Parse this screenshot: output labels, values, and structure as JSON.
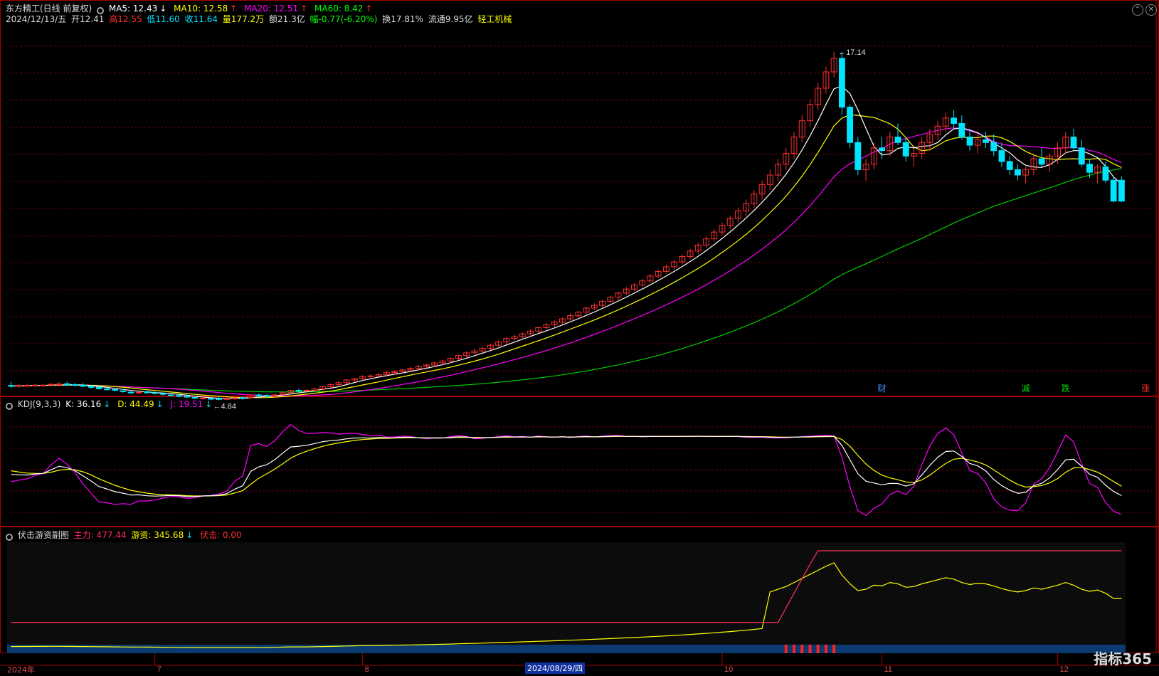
{
  "main_panel": {
    "title": "东方精工(日线 前复权)",
    "ma": [
      {
        "label": "MA5: 12.43",
        "arrow": "↓",
        "color": "#ffffff"
      },
      {
        "label": "MA10: 12.58",
        "arrow": "↑",
        "color": "#ffff00"
      },
      {
        "label": "MA20: 12.51",
        "arrow": "↑",
        "color": "#ff00ff"
      },
      {
        "label": "MA60: 8.42",
        "arrow": "↑",
        "color": "#00ff00"
      }
    ],
    "info": {
      "date": "2024/12/13/五",
      "open": "开12.41",
      "high": "高12.55",
      "low": "低11.60",
      "close": "收11.64",
      "volume": "量177.2万",
      "amount": "额21.3亿",
      "change": "幅-0.77(-6.20%)",
      "turnover": "换17.81%",
      "float": "流通9.95亿",
      "sector": "轻工机械"
    },
    "max_label": "17.14",
    "min_label": "4.84",
    "signals": [
      {
        "text": "财",
        "color": "#4a90ff",
        "day": 109
      },
      {
        "text": "减",
        "color": "#00e000",
        "day": 127
      },
      {
        "text": "跌",
        "color": "#00e000",
        "day": 132
      },
      {
        "text": "涨",
        "color": "#ff3030",
        "day": 142
      }
    ]
  },
  "kdj_panel": {
    "name": "KDJ(9,3,3)",
    "values": [
      {
        "label": "K: 36.16",
        "arrow": "↓",
        "color": "#ffffff"
      },
      {
        "label": "D: 44.49",
        "arrow": "↓",
        "color": "#ffff00"
      },
      {
        "label": "J: 19.51",
        "arrow": "↓",
        "color": "#ff00ff"
      }
    ]
  },
  "sub_panel": {
    "name": "伏击游资副图",
    "values": [
      {
        "label": "主力: 477.44",
        "color": "#ff3060"
      },
      {
        "label": "游资: 345.68",
        "color": "#ffff00",
        "arrow": "↓"
      },
      {
        "label": "伏击: 0.00",
        "color": "#ff3030"
      }
    ]
  },
  "x_axis": {
    "year_label": "2024年",
    "month_labels": [
      {
        "text": "7",
        "day": 18
      },
      {
        "text": "8",
        "day": 44
      },
      {
        "text": "10",
        "day": 89
      },
      {
        "text": "11",
        "day": 109
      },
      {
        "text": "12",
        "day": 131
      }
    ],
    "cursor_date": "2024/08/29/四"
  },
  "brand": "指标365",
  "colors": {
    "up": "#ff3030",
    "down": "#00e5ff",
    "ma5": "#ffffff",
    "ma10": "#ffff00",
    "ma20": "#ff00ff",
    "ma60": "#00cc00",
    "grid": "#6a0000",
    "frame": "#a00000"
  },
  "chart_data": {
    "type": "candlestick",
    "y_range": [
      4.5,
      18.0
    ],
    "ohlc": [
      [
        4.85,
        4.98,
        4.76,
        4.82
      ],
      [
        4.82,
        4.9,
        4.76,
        4.85
      ],
      [
        4.85,
        4.92,
        4.8,
        4.85
      ],
      [
        4.84,
        4.92,
        4.79,
        4.86
      ],
      [
        4.85,
        4.91,
        4.79,
        4.86
      ],
      [
        4.87,
        4.94,
        4.82,
        4.89
      ],
      [
        4.89,
        4.98,
        4.81,
        4.9
      ],
      [
        4.91,
        4.99,
        4.83,
        4.87
      ],
      [
        4.88,
        4.95,
        4.81,
        4.85
      ],
      [
        4.86,
        4.93,
        4.78,
        4.82
      ],
      [
        4.82,
        4.87,
        4.73,
        4.78
      ],
      [
        4.78,
        4.85,
        4.7,
        4.73
      ],
      [
        4.72,
        4.79,
        4.66,
        4.71
      ],
      [
        4.7,
        4.74,
        4.63,
        4.67
      ],
      [
        4.65,
        4.71,
        4.58,
        4.63
      ],
      [
        4.6,
        4.66,
        4.54,
        4.58
      ],
      [
        4.59,
        4.66,
        4.54,
        4.6
      ],
      [
        4.62,
        4.68,
        4.54,
        4.58
      ],
      [
        4.58,
        4.63,
        4.52,
        4.56
      ],
      [
        4.55,
        4.6,
        4.48,
        4.53
      ],
      [
        4.5,
        4.56,
        4.44,
        4.49
      ],
      [
        4.48,
        4.55,
        4.41,
        4.45
      ],
      [
        4.45,
        4.51,
        4.39,
        4.42
      ],
      [
        4.41,
        4.46,
        4.34,
        4.38
      ],
      [
        4.38,
        4.44,
        4.33,
        4.38
      ],
      [
        4.37,
        4.42,
        4.31,
        4.36
      ],
      [
        4.36,
        4.42,
        4.3,
        4.35
      ],
      [
        4.36,
        4.41,
        4.31,
        4.36
      ],
      [
        4.37,
        4.44,
        4.31,
        4.39
      ],
      [
        4.4,
        4.45,
        4.32,
        4.39
      ],
      [
        4.4,
        4.53,
        4.36,
        4.5
      ],
      [
        4.5,
        4.56,
        4.41,
        4.47
      ],
      [
        4.48,
        4.53,
        4.4,
        4.46
      ],
      [
        4.46,
        4.55,
        4.41,
        4.5
      ],
      [
        4.52,
        4.61,
        4.48,
        4.58
      ],
      [
        4.58,
        4.68,
        4.53,
        4.67
      ],
      [
        4.67,
        4.73,
        4.62,
        4.66
      ],
      [
        4.66,
        4.72,
        4.6,
        4.67
      ],
      [
        4.67,
        4.76,
        4.62,
        4.72
      ],
      [
        4.72,
        4.83,
        4.67,
        4.8
      ],
      [
        4.8,
        4.92,
        4.76,
        4.88
      ],
      [
        4.88,
        5.0,
        4.8,
        4.95
      ],
      [
        4.95,
        5.08,
        4.89,
        5.05
      ],
      [
        5.05,
        5.13,
        4.98,
        5.1
      ],
      [
        5.1,
        5.22,
        5.04,
        5.18
      ],
      [
        5.18,
        5.25,
        5.1,
        5.2
      ],
      [
        5.2,
        5.28,
        5.13,
        5.25
      ],
      [
        5.25,
        5.38,
        5.18,
        5.32
      ],
      [
        5.32,
        5.4,
        5.25,
        5.36
      ],
      [
        5.36,
        5.45,
        5.3,
        5.42
      ],
      [
        5.42,
        5.52,
        5.35,
        5.48
      ],
      [
        5.48,
        5.6,
        5.4,
        5.55
      ],
      [
        5.55,
        5.65,
        5.48,
        5.6
      ],
      [
        5.6,
        5.72,
        5.52,
        5.68
      ],
      [
        5.68,
        5.8,
        5.6,
        5.75
      ],
      [
        5.75,
        5.88,
        5.68,
        5.85
      ],
      [
        5.85,
        5.98,
        5.78,
        5.95
      ],
      [
        5.95,
        6.1,
        5.88,
        6.05
      ],
      [
        6.05,
        6.2,
        5.98,
        6.12
      ],
      [
        6.12,
        6.28,
        6.05,
        6.22
      ],
      [
        6.22,
        6.38,
        6.15,
        6.33
      ],
      [
        6.33,
        6.5,
        6.28,
        6.45
      ],
      [
        6.45,
        6.62,
        6.38,
        6.58
      ],
      [
        6.58,
        6.72,
        6.5,
        6.65
      ],
      [
        6.65,
        6.8,
        6.58,
        6.75
      ],
      [
        6.75,
        6.92,
        6.68,
        6.85
      ],
      [
        6.85,
        7.02,
        6.78,
        6.98
      ],
      [
        6.98,
        7.15,
        6.9,
        7.08
      ],
      [
        7.08,
        7.25,
        7.0,
        7.18
      ],
      [
        7.18,
        7.35,
        7.1,
        7.3
      ],
      [
        7.3,
        7.5,
        7.22,
        7.42
      ],
      [
        7.42,
        7.6,
        7.35,
        7.55
      ],
      [
        7.55,
        7.75,
        7.48,
        7.7
      ],
      [
        7.7,
        7.88,
        7.62,
        7.8
      ],
      [
        7.8,
        8.0,
        7.72,
        7.95
      ],
      [
        7.95,
        8.15,
        7.88,
        8.1
      ],
      [
        8.1,
        8.3,
        8.0,
        8.25
      ],
      [
        8.25,
        8.48,
        8.18,
        8.4
      ],
      [
        8.4,
        8.62,
        8.32,
        8.55
      ],
      [
        8.55,
        8.78,
        8.48,
        8.7
      ],
      [
        8.7,
        8.95,
        8.62,
        8.88
      ],
      [
        8.88,
        9.12,
        8.8,
        9.05
      ],
      [
        9.05,
        9.3,
        8.98,
        9.22
      ],
      [
        9.22,
        9.48,
        9.12,
        9.4
      ],
      [
        9.4,
        9.68,
        9.3,
        9.6
      ],
      [
        9.6,
        9.88,
        9.5,
        9.8
      ],
      [
        9.8,
        10.1,
        9.7,
        10.02
      ],
      [
        10.02,
        10.35,
        9.92,
        10.25
      ],
      [
        10.25,
        10.6,
        10.15,
        10.5
      ],
      [
        10.5,
        10.85,
        10.38,
        10.75
      ],
      [
        10.75,
        11.1,
        10.6,
        11.0
      ],
      [
        11.0,
        11.4,
        10.85,
        11.28
      ],
      [
        11.28,
        11.7,
        11.1,
        11.55
      ],
      [
        11.55,
        12.05,
        11.4,
        11.9
      ],
      [
        11.9,
        12.4,
        11.7,
        12.25
      ],
      [
        12.25,
        12.8,
        12.05,
        12.6
      ],
      [
        12.6,
        13.2,
        12.4,
        13.0
      ],
      [
        13.0,
        13.6,
        12.8,
        13.4
      ],
      [
        13.4,
        14.2,
        13.2,
        14.0
      ],
      [
        14.0,
        14.8,
        13.8,
        14.6
      ],
      [
        14.6,
        15.4,
        14.4,
        15.2
      ],
      [
        15.2,
        16.0,
        15.0,
        15.8
      ],
      [
        15.8,
        16.6,
        15.6,
        16.4
      ],
      [
        16.4,
        17.14,
        16.2,
        16.9
      ],
      [
        16.9,
        17.14,
        14.8,
        15.1
      ],
      [
        15.1,
        15.2,
        13.6,
        13.8
      ],
      [
        13.8,
        14.0,
        12.6,
        12.8
      ],
      [
        12.8,
        13.2,
        12.4,
        13.0
      ],
      [
        13.0,
        13.8,
        12.8,
        13.6
      ],
      [
        13.6,
        14.0,
        13.2,
        13.5
      ],
      [
        13.5,
        14.2,
        13.3,
        14.0
      ],
      [
        14.0,
        14.5,
        13.7,
        13.8
      ],
      [
        13.8,
        14.0,
        13.1,
        13.3
      ],
      [
        13.3,
        13.6,
        12.9,
        13.4
      ],
      [
        13.4,
        14.0,
        13.2,
        13.8
      ],
      [
        13.8,
        14.3,
        13.5,
        14.1
      ],
      [
        14.1,
        14.6,
        13.9,
        14.4
      ],
      [
        14.4,
        14.9,
        14.2,
        14.7
      ],
      [
        14.7,
        15.0,
        14.3,
        14.5
      ],
      [
        14.5,
        14.8,
        13.9,
        14.0
      ],
      [
        14.0,
        14.3,
        13.5,
        13.7
      ],
      [
        13.7,
        14.1,
        13.4,
        13.9
      ],
      [
        13.9,
        14.2,
        13.6,
        13.8
      ],
      [
        13.8,
        14.1,
        13.3,
        13.5
      ],
      [
        13.5,
        13.8,
        12.9,
        13.1
      ],
      [
        13.1,
        13.3,
        12.6,
        12.8
      ],
      [
        12.8,
        13.0,
        12.4,
        12.6
      ],
      [
        12.6,
        12.9,
        12.3,
        12.8
      ],
      [
        12.8,
        13.4,
        12.6,
        13.2
      ],
      [
        13.2,
        13.6,
        12.9,
        13.0
      ],
      [
        13.0,
        13.4,
        12.7,
        13.3
      ],
      [
        13.3,
        13.8,
        13.0,
        13.6
      ],
      [
        13.6,
        14.2,
        13.4,
        14.0
      ],
      [
        14.0,
        14.3,
        13.5,
        13.6
      ],
      [
        13.6,
        13.9,
        12.9,
        13.0
      ],
      [
        13.0,
        13.2,
        12.5,
        12.7
      ],
      [
        12.7,
        13.0,
        12.3,
        12.9
      ],
      [
        12.9,
        13.1,
        12.3,
        12.41
      ],
      [
        12.41,
        12.55,
        11.6,
        11.64
      ],
      [
        12.41,
        12.55,
        11.6,
        11.64
      ]
    ]
  }
}
